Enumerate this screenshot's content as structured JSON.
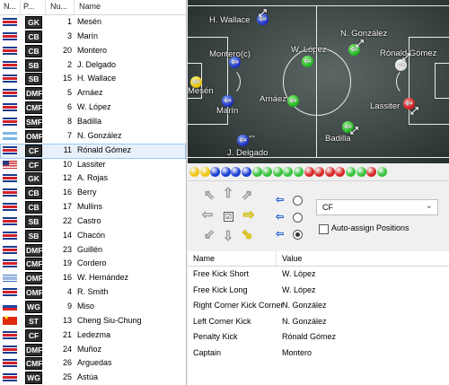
{
  "squad": {
    "headers": {
      "nat": "N...",
      "pos": "P...",
      "num": "Nu...",
      "name": "Name"
    },
    "rows": [
      {
        "flag": "cr",
        "pos": "GK",
        "num": "1",
        "name": "Mesén"
      },
      {
        "flag": "cr",
        "pos": "CB",
        "num": "3",
        "name": "Marín"
      },
      {
        "flag": "cr",
        "pos": "CB",
        "num": "20",
        "name": "Montero"
      },
      {
        "flag": "cr",
        "pos": "SB",
        "num": "2",
        "name": "J. Delgado"
      },
      {
        "flag": "cr",
        "pos": "SB",
        "num": "15",
        "name": "H. Wallace"
      },
      {
        "flag": "cr",
        "pos": "DMF",
        "num": "5",
        "name": "Arnáez"
      },
      {
        "flag": "cr",
        "pos": "CMF",
        "num": "6",
        "name": "W. López"
      },
      {
        "flag": "cr",
        "pos": "SMF",
        "num": "8",
        "name": "Badilla"
      },
      {
        "flag": "ar",
        "pos": "OMF",
        "num": "7",
        "name": "N. González"
      },
      {
        "flag": "cr",
        "pos": "CF",
        "num": "11",
        "name": "Rónald Gómez"
      },
      {
        "flag": "us",
        "pos": "CF",
        "num": "10",
        "name": "Lassiter"
      },
      {
        "flag": "cr",
        "pos": "GK",
        "num": "12",
        "name": "A. Rojas"
      },
      {
        "flag": "cr",
        "pos": "CB",
        "num": "16",
        "name": "Berry"
      },
      {
        "flag": "cr",
        "pos": "CB",
        "num": "17",
        "name": "Mullins"
      },
      {
        "flag": "cr",
        "pos": "SB",
        "num": "22",
        "name": "Castro"
      },
      {
        "flag": "cr",
        "pos": "SB",
        "num": "14",
        "name": "Chacón"
      },
      {
        "flag": "cr",
        "pos": "DMF",
        "num": "23",
        "name": "Guillén"
      },
      {
        "flag": "cr",
        "pos": "CMF",
        "num": "19",
        "name": "Cordero"
      },
      {
        "flag": "uy",
        "pos": "OMF",
        "num": "16",
        "name": "W. Hernández"
      },
      {
        "flag": "cr",
        "pos": "OMF",
        "num": "4",
        "name": "R. Smith"
      },
      {
        "flag": "ru",
        "pos": "WG",
        "num": "9",
        "name": "Miso"
      },
      {
        "flag": "cn",
        "pos": "ST",
        "num": "13",
        "name": "Cheng Siu-Chung"
      },
      {
        "flag": "cr",
        "pos": "CF",
        "num": "21",
        "name": "Ledezma"
      },
      {
        "flag": "cr",
        "pos": "DMF",
        "num": "24",
        "name": "Muñoz"
      },
      {
        "flag": "cr",
        "pos": "CMF",
        "num": "26",
        "name": "Arguedas"
      },
      {
        "flag": "cr",
        "pos": "WG",
        "num": "25",
        "name": "Astúa"
      }
    ],
    "selected_row": 9
  },
  "pitch": {
    "players": [
      {
        "name": "H. Wallace",
        "color": "blue"
      },
      {
        "name": "N. González",
        "color": "green"
      },
      {
        "name": "W. López",
        "color": "green"
      },
      {
        "name": "Montero(c)",
        "color": "blue"
      },
      {
        "name": "Rónald Gómez",
        "color": "white"
      },
      {
        "name": "Mesén",
        "color": "yellow"
      },
      {
        "name": "Arnáez",
        "color": "green"
      },
      {
        "name": "Marín",
        "color": "blue"
      },
      {
        "name": "Lassiter",
        "color": "red"
      },
      {
        "name": "Badilla",
        "color": "green"
      },
      {
        "name": "J. Delgado",
        "color": "blue"
      }
    ]
  },
  "ball_colors": [
    "#f1c40f",
    "#f1c40f",
    "#1a3fd6",
    "#1a3fd6",
    "#1a3fd6",
    "#1a3fd6",
    "#35c33a",
    "#35c33a",
    "#35c33a",
    "#35c33a",
    "#35c33a",
    "#d92626",
    "#d92626",
    "#d92626",
    "#d92626",
    "#35c33a",
    "#35c33a",
    "#d92626",
    "#35c33a"
  ],
  "controls": {
    "position_select": "CF",
    "auto_assign_label": "Auto-assign Positions",
    "mentality_selected": 2
  },
  "properties": {
    "headers": {
      "name": "Name",
      "value": "Value"
    },
    "rows": [
      {
        "name": "Free Kick Short",
        "value": "W. López"
      },
      {
        "name": "Free Kick Long",
        "value": "W. López"
      },
      {
        "name": "Right Corner Kick Corner",
        "value": "N. González"
      },
      {
        "name": "Left Corner Kick",
        "value": "N. González"
      },
      {
        "name": "Penalty Kick",
        "value": "Rónald Gómez"
      },
      {
        "name": "Captain",
        "value": "Montero"
      }
    ]
  }
}
